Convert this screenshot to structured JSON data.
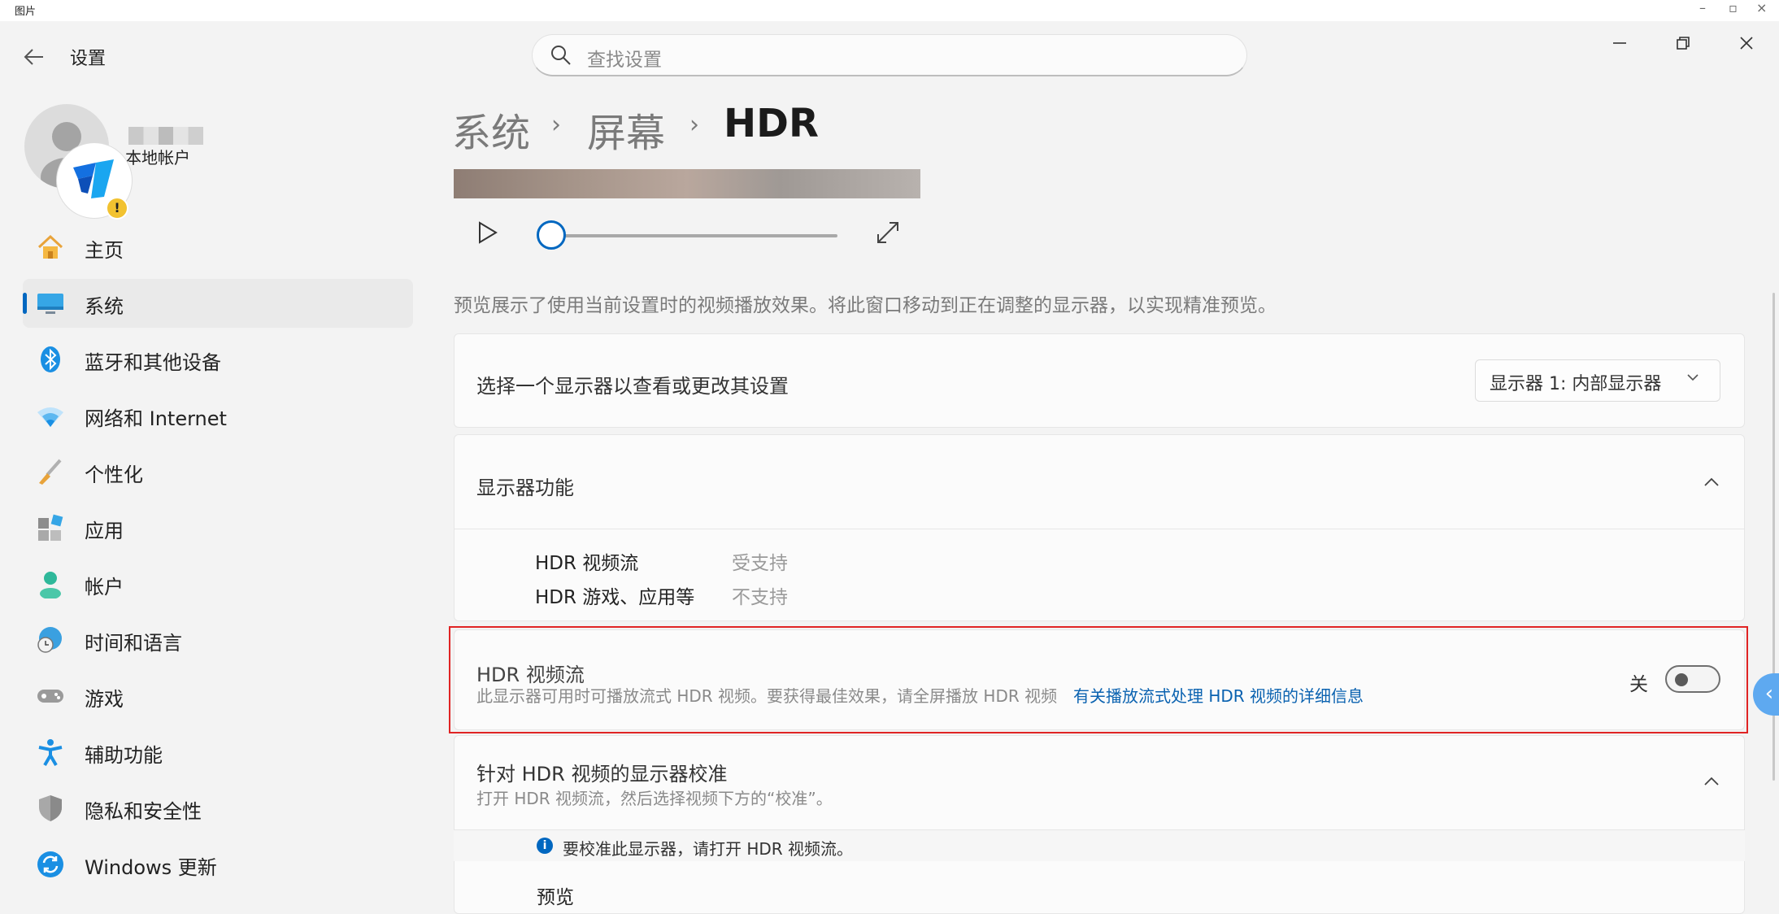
{
  "outer_window": {
    "title": "图片"
  },
  "header": {
    "app_title": "设置",
    "search_placeholder": "查找设置"
  },
  "user": {
    "account_type": "本地帐户"
  },
  "sidebar": {
    "items": [
      {
        "label": "主页",
        "icon": "home-icon",
        "active": false
      },
      {
        "label": "系统",
        "icon": "monitor-icon",
        "active": true
      },
      {
        "label": "蓝牙和其他设备",
        "icon": "bluetooth-icon",
        "active": false
      },
      {
        "label": "网络和 Internet",
        "icon": "wifi-icon",
        "active": false
      },
      {
        "label": "个性化",
        "icon": "brush-icon",
        "active": false
      },
      {
        "label": "应用",
        "icon": "apps-icon",
        "active": false
      },
      {
        "label": "帐户",
        "icon": "person-icon",
        "active": false
      },
      {
        "label": "时间和语言",
        "icon": "globe-clock-icon",
        "active": false
      },
      {
        "label": "游戏",
        "icon": "gamepad-icon",
        "active": false
      },
      {
        "label": "辅助功能",
        "icon": "accessibility-icon",
        "active": false
      },
      {
        "label": "隐私和安全性",
        "icon": "shield-icon",
        "active": false
      },
      {
        "label": "Windows 更新",
        "icon": "sync-icon",
        "active": false
      }
    ]
  },
  "breadcrumb": {
    "items": [
      "系统",
      "屏幕"
    ],
    "current": "HDR",
    "separator": "›"
  },
  "preview": {
    "progress": 0,
    "description": "预览展示了使用当前设置时的视频播放效果。将此窗口移动到正在调整的显示器，以实现精准预览。"
  },
  "display_select": {
    "label": "选择一个显示器以查看或更改其设置",
    "value": "显示器 1: 内部显示器"
  },
  "display_features": {
    "title": "显示器功能",
    "rows": [
      {
        "label": "HDR 视频流",
        "value": "受支持"
      },
      {
        "label": "HDR 游戏、应用等",
        "value": "不支持"
      }
    ]
  },
  "hdr_stream": {
    "title": "HDR 视频流",
    "description": "此显示器可用时可播放流式 HDR 视频。要获得最佳效果，请全屏播放 HDR 视频",
    "link": "有关播放流式处理 HDR 视频的详细信息",
    "toggle_label": "关",
    "toggle_on": false
  },
  "calibration": {
    "title": "针对 HDR 视频的显示器校准",
    "subtitle": "打开 HDR 视频流，然后选择视频下方的“校准”。",
    "info": "要校准此显示器，请打开 HDR 视频流。",
    "preview_label": "预览"
  },
  "colors": {
    "accent": "#0067c0",
    "highlight_border": "#e02424"
  }
}
